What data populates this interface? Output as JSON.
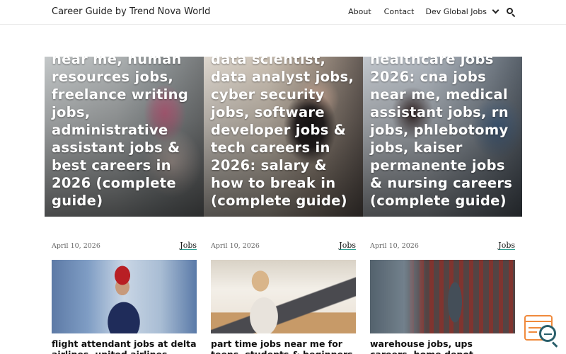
{
  "header": {
    "site_title": "Career Guide by Trend Nova World",
    "nav": {
      "about": "About",
      "contact": "Contact",
      "dropdown": "Dev Global Jobs"
    }
  },
  "featured": [
    {
      "title": "near me, human resources jobs, freelance writing jobs, administrative assistant jobs & best careers in 2026 (complete guide)"
    },
    {
      "title": "data scientist, data analyst jobs, cyber security jobs, software developer jobs & tech careers in 2026: salary & how to break in (complete guide)"
    },
    {
      "title": "healthcare jobs 2026: cna jobs near me, medical assistant jobs, rn jobs, phlebotomy jobs, kaiser permanente jobs & nursing careers (complete guide)"
    }
  ],
  "posts": [
    {
      "date": "April 10, 2026",
      "category": "Jobs",
      "title": "flight attendant jobs at delta airlines, united airlines"
    },
    {
      "date": "April 10, 2026",
      "category": "Jobs",
      "title": "part time jobs near me for teens, students & beginners"
    },
    {
      "date": "April 10, 2026",
      "category": "Jobs",
      "title": "warehouse jobs, ups careers, home depot"
    }
  ],
  "colors": {
    "category_underline": "#2a9d8f",
    "widget_accent": "#f08a3c",
    "widget_lens": "#2a5f6b"
  },
  "icons": {
    "search": "search-icon",
    "dropdown": "chevron-down-icon",
    "widget": "search-document-icon"
  }
}
